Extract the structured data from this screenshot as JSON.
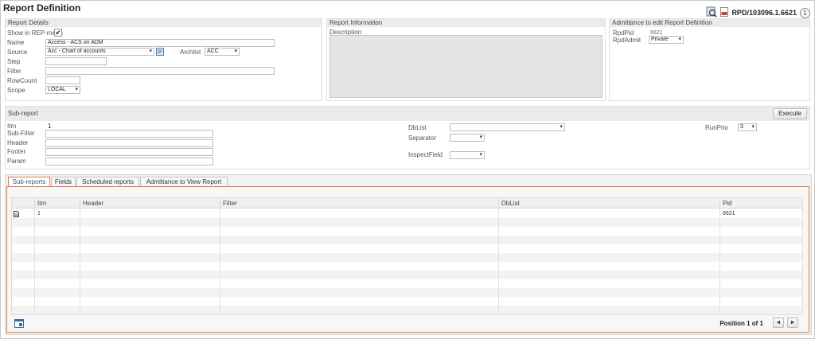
{
  "page": {
    "title": "Report Definition",
    "record_id": "RPD/103096.1.6621",
    "help_label": "1"
  },
  "report_details": {
    "heading": "Report Details",
    "show_in_rep_menu_label": "Show in REP-menu",
    "show_in_rep_menu_checked": "✔",
    "name_label": "Name",
    "name_value": "Access - ACS on ADM",
    "source_label": "Source",
    "source_value": "Acc - Chart of accounts",
    "archlist_label": "Archlist",
    "archlist_value": "ACC",
    "step_label": "Step",
    "step_value": "",
    "filter_label": "Filter",
    "filter_value": "",
    "rowcount_label": "RowCount",
    "rowcount_value": "",
    "scope_label": "Scope",
    "scope_value": "LOCAL"
  },
  "report_information": {
    "heading": "Report Information",
    "description_label": "Description",
    "description_value": ""
  },
  "admittance": {
    "heading": "Admittance to edit Report Definition",
    "rpdpid_label": "RpdPid",
    "rpdpid_value": "6621",
    "rpdadmit_label": "RpdAdmit",
    "rpdadmit_value": "Private"
  },
  "subreport": {
    "heading": "Sub-report",
    "execute_label": "Execute",
    "itm_label": "Itm",
    "itm_value": "1",
    "subfilter_label": "Sub-Filter",
    "header_label": "Header",
    "footer_label": "Footer",
    "param_label": "Param",
    "dblist_label": "DbList",
    "separator_label": "Separator",
    "inspectfield_label": "InspectField",
    "runprio_label": "RunPrio",
    "runprio_value": "3"
  },
  "tabs": [
    {
      "label": "Sub-reports"
    },
    {
      "label": "Fields"
    },
    {
      "label": "Scheduled reports"
    },
    {
      "label": "Admittance to View Report"
    }
  ],
  "grid": {
    "columns": [
      "Itm",
      "Header",
      "Filter",
      "DbList",
      "Pid"
    ],
    "rows": [
      {
        "itm": "1",
        "header": "",
        "filter": "",
        "dblist": "",
        "pid": "6621"
      }
    ],
    "pager_text": "Position 1 of 1",
    "prev_label": "◄",
    "next_label": "►"
  },
  "icons": [
    "search-icon",
    "pdf-icon",
    "lookup-icon",
    "document-icon",
    "grid-settings-icon"
  ],
  "colors": {
    "accent": "#e07a46",
    "link": "#3a6ea8",
    "panel_header": "#ebebeb"
  }
}
